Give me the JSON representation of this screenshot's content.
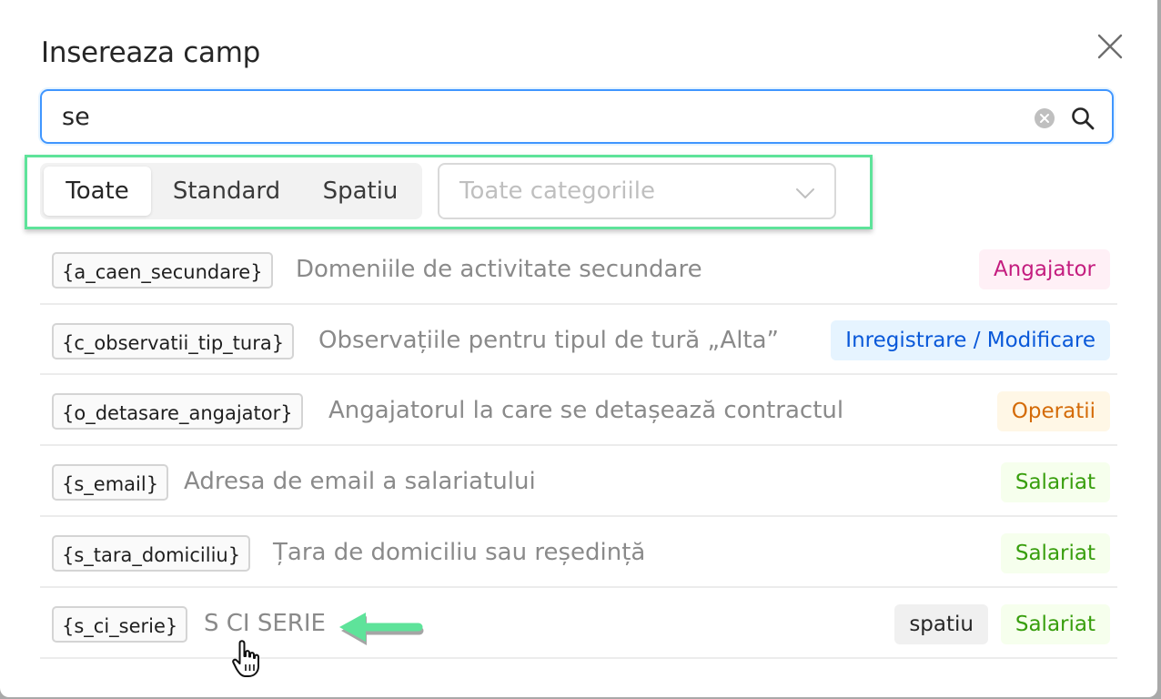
{
  "dialog": {
    "title": "Insereaza camp"
  },
  "search": {
    "value": "se"
  },
  "filter": {
    "tabs": [
      {
        "label": "Toate",
        "active": true
      },
      {
        "label": "Standard",
        "active": false
      },
      {
        "label": "Spatiu",
        "active": false
      }
    ],
    "category_placeholder": "Toate categoriile"
  },
  "fields": [
    {
      "code": "{a_caen_secundare}",
      "description": "Domeniile de activitate secundare",
      "tags": [
        "Angajator"
      ]
    },
    {
      "code": "{c_observatii_tip_tura}",
      "description": "Observațiile pentru tipul de tură „Alta”",
      "tags": [
        "Inregistrare / Modificare"
      ]
    },
    {
      "code": "{o_detasare_angajator}",
      "description": "Angajatorul la care se detașează contractul",
      "tags": [
        "Operatii"
      ]
    },
    {
      "code": "{s_email}",
      "description": "Adresa de email a salariatului",
      "tags": [
        "Salariat"
      ]
    },
    {
      "code": "{s_tara_domiciliu}",
      "description": "Țara de domiciliu sau reședință",
      "tags": [
        "Salariat"
      ]
    },
    {
      "code": "{s_ci_serie}",
      "description": "S CI SERIE",
      "tags": [
        "spatiu",
        "Salariat"
      ]
    }
  ],
  "colors": {
    "accent": "#4096ff",
    "annotation_green": "#5ee39a",
    "tag_angajator": "#c41d7f",
    "tag_inregistrare": "#0958d9",
    "tag_operatii": "#d46b08",
    "tag_salariat": "#389e0d"
  },
  "icons": {
    "close": "close-icon",
    "clear": "clear-circle-icon",
    "search": "search-icon",
    "dropdown": "chevron-down-icon"
  }
}
